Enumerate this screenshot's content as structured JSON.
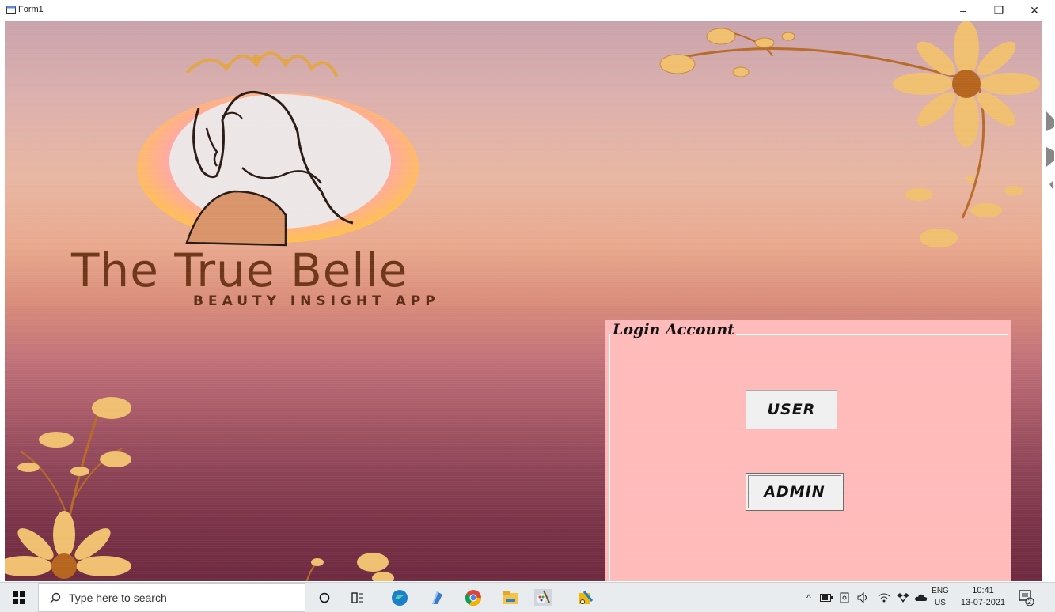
{
  "window": {
    "title": "Form1",
    "minimize_glyph": "–",
    "maximize_glyph": "❐",
    "close_glyph": "✕"
  },
  "brand": {
    "title": "The True Belle",
    "subtitle": "BEAUTY INSIGHT APP"
  },
  "login": {
    "group_label": "Login Account",
    "user_button": "USER",
    "admin_button": "ADMIN"
  },
  "taskbar": {
    "search_placeholder": "Type here to search",
    "language_top": "ENG",
    "language_bottom": "US",
    "time": "10:41",
    "date": "13-07-2021",
    "notification_count": "2",
    "pinned_icons": [
      "cortana-icon",
      "task-view-icon",
      "edge-icon",
      "notepad-icon",
      "chrome-icon",
      "file-explorer-icon",
      "paint-icon",
      "snipping-icon"
    ],
    "tray_icons": [
      "chevron-up-icon",
      "battery-icon",
      "meet-icon",
      "volume-icon",
      "wifi-icon",
      "dropbox-icon",
      "onedrive-icon"
    ]
  },
  "colors": {
    "panel": "#ffbaba",
    "brand_text": "#6e3618",
    "flower_petal": "#f0c070",
    "flower_center": "#b5651d"
  }
}
